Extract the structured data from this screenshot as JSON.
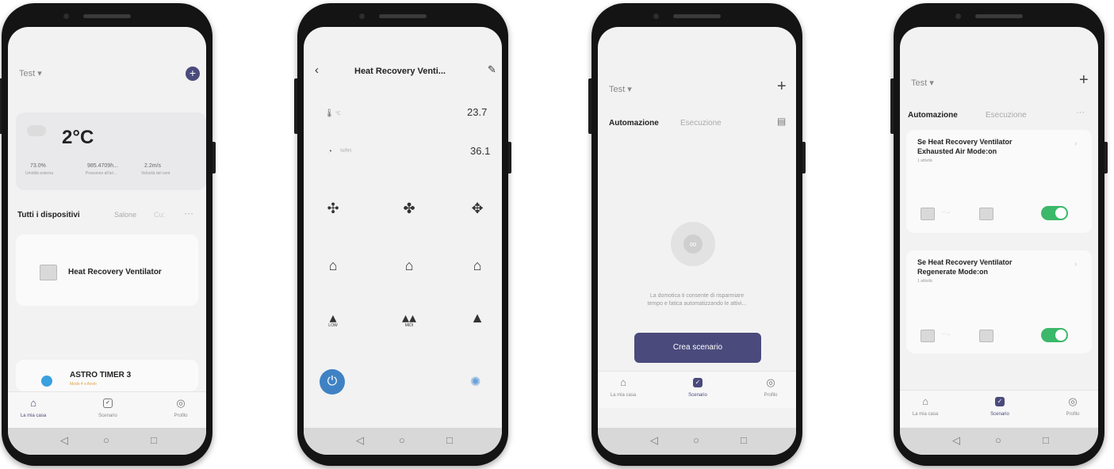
{
  "phone1": {
    "home_name": "Test",
    "temp": "2°C",
    "weather": [
      {
        "value": "73.0%",
        "label": "Umidità esterna"
      },
      {
        "value": "985.4709h...",
        "label": "Pressione all'ari..."
      },
      {
        "value": "2.2m/s",
        "label": "Velocità del vent"
      }
    ],
    "tabs": [
      "Tutti i dispositivi",
      "Salone",
      "Cu:"
    ],
    "device1": "Heat Recovery Ventilator",
    "device2": "ASTRO TIMER 3",
    "device2_status": "Modo 4 x Avvio",
    "nav": [
      "La mia casa",
      "Scenario",
      "Profilo"
    ]
  },
  "phone2": {
    "title": "Heat Recovery Venti...",
    "temp_unit": "℃",
    "temp_value": "23.7",
    "hum_unit": "%RH",
    "hum_value": "36.1",
    "speed_labels": [
      "LOW",
      "MIDI"
    ]
  },
  "phone3": {
    "home_name": "Test",
    "tab_active": "Automazione",
    "tab_other": "Esecuzione",
    "empty_text_1": "La domotica ti consente di risparmiare",
    "empty_text_2": "tempo e fatica automatizzando le attivi...",
    "create_button": "Crea scenario",
    "nav": [
      "La mia casa",
      "Scenario",
      "Profilo"
    ]
  },
  "phone4": {
    "home_name": "Test",
    "tab_active": "Automazione",
    "tab_other": "Esecuzione",
    "rules": [
      {
        "title1": "Se Heat Recovery Ventilator",
        "title2": "Exhausted Air Mode:on",
        "count": "1 attività"
      },
      {
        "title1": "Se Heat Recovery Ventilator",
        "title2": "Regenerate Mode:on",
        "count": "1 attività"
      }
    ],
    "nav": [
      "La mia casa",
      "Scenario",
      "Profilo"
    ]
  },
  "colors": {
    "accent": "#4a4a7c",
    "toggle_on": "#3bb86a",
    "power_blue": "#3f82c4"
  }
}
